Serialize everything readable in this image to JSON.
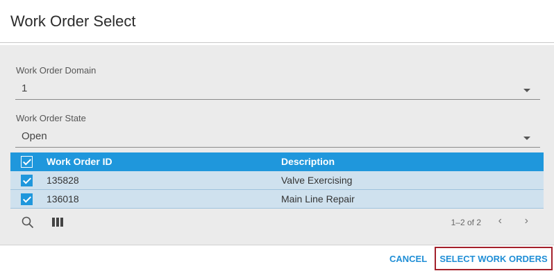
{
  "dialog": {
    "title": "Work Order Select"
  },
  "fields": {
    "domain": {
      "label": "Work Order Domain",
      "value": "1"
    },
    "state": {
      "label": "Work Order State",
      "value": "Open"
    }
  },
  "grid": {
    "columns": {
      "id": "Work Order ID",
      "description": "Description"
    },
    "rows": [
      {
        "id": "135828",
        "description": "Valve Exercising",
        "checked": true
      },
      {
        "id": "136018",
        "description": "Main Line Repair",
        "checked": true
      }
    ],
    "pagination": {
      "info": "1–2 of 2",
      "prev": "‹",
      "next": "›"
    }
  },
  "actions": {
    "cancel": "CANCEL",
    "select": "SELECT WORK ORDERS"
  },
  "colors": {
    "accent": "#1f97dc",
    "row_selected": "#cfe1ee",
    "focus_border": "#a3202a"
  },
  "icons": {
    "search": "search-icon",
    "columns": "columns-icon",
    "checkbox": "checkbox-checked-icon",
    "dropdown": "caret-down-icon"
  }
}
